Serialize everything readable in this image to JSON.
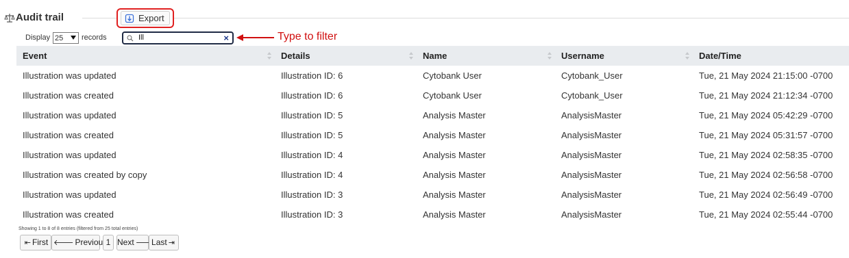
{
  "header": {
    "title": "Audit trail",
    "title_icon": "scale-icon",
    "export_label": "Export",
    "export_icon": "download-icon"
  },
  "controls": {
    "display_label": "Display",
    "page_size": "25",
    "records_label": "records",
    "search_value": "Ill"
  },
  "annotation": {
    "text": "Type to filter",
    "color": "#d01010"
  },
  "table": {
    "columns": [
      "Event",
      "Details",
      "Name",
      "Username",
      "Date/Time"
    ],
    "rows": [
      [
        "Illustration was updated",
        "Illustration ID: 6",
        "Cytobank User",
        "Cytobank_User",
        "Tue, 21 May 2024 21:15:00 -0700"
      ],
      [
        "Illustration was created",
        "Illustration ID: 6",
        "Cytobank User",
        "Cytobank_User",
        "Tue, 21 May 2024 21:12:34 -0700"
      ],
      [
        "Illustration was updated",
        "Illustration ID: 5",
        "Analysis Master",
        "AnalysisMaster",
        "Tue, 21 May 2024 05:42:29 -0700"
      ],
      [
        "Illustration was created",
        "Illustration ID: 5",
        "Analysis Master",
        "AnalysisMaster",
        "Tue, 21 May 2024 05:31:57 -0700"
      ],
      [
        "Illustration was updated",
        "Illustration ID: 4",
        "Analysis Master",
        "AnalysisMaster",
        "Tue, 21 May 2024 02:58:35 -0700"
      ],
      [
        "Illustration was created by copy",
        "Illustration ID: 4",
        "Analysis Master",
        "AnalysisMaster",
        "Tue, 21 May 2024 02:56:58 -0700"
      ],
      [
        "Illustration was updated",
        "Illustration ID: 3",
        "Analysis Master",
        "AnalysisMaster",
        "Tue, 21 May 2024 02:56:49 -0700"
      ],
      [
        "Illustration was created",
        "Illustration ID: 3",
        "Analysis Master",
        "AnalysisMaster",
        "Tue, 21 May 2024 02:55:44 -0700"
      ]
    ]
  },
  "info": "Showing 1 to 8 of 8 entries (filtered from 25 total entries)",
  "pager": {
    "first": "First",
    "previous": "Previous",
    "page": "1",
    "next": "Next",
    "last": "Last"
  },
  "colors": {
    "highlight": "#e02020",
    "header_bg": "#e9ecef",
    "search_border": "#1f2a44"
  }
}
